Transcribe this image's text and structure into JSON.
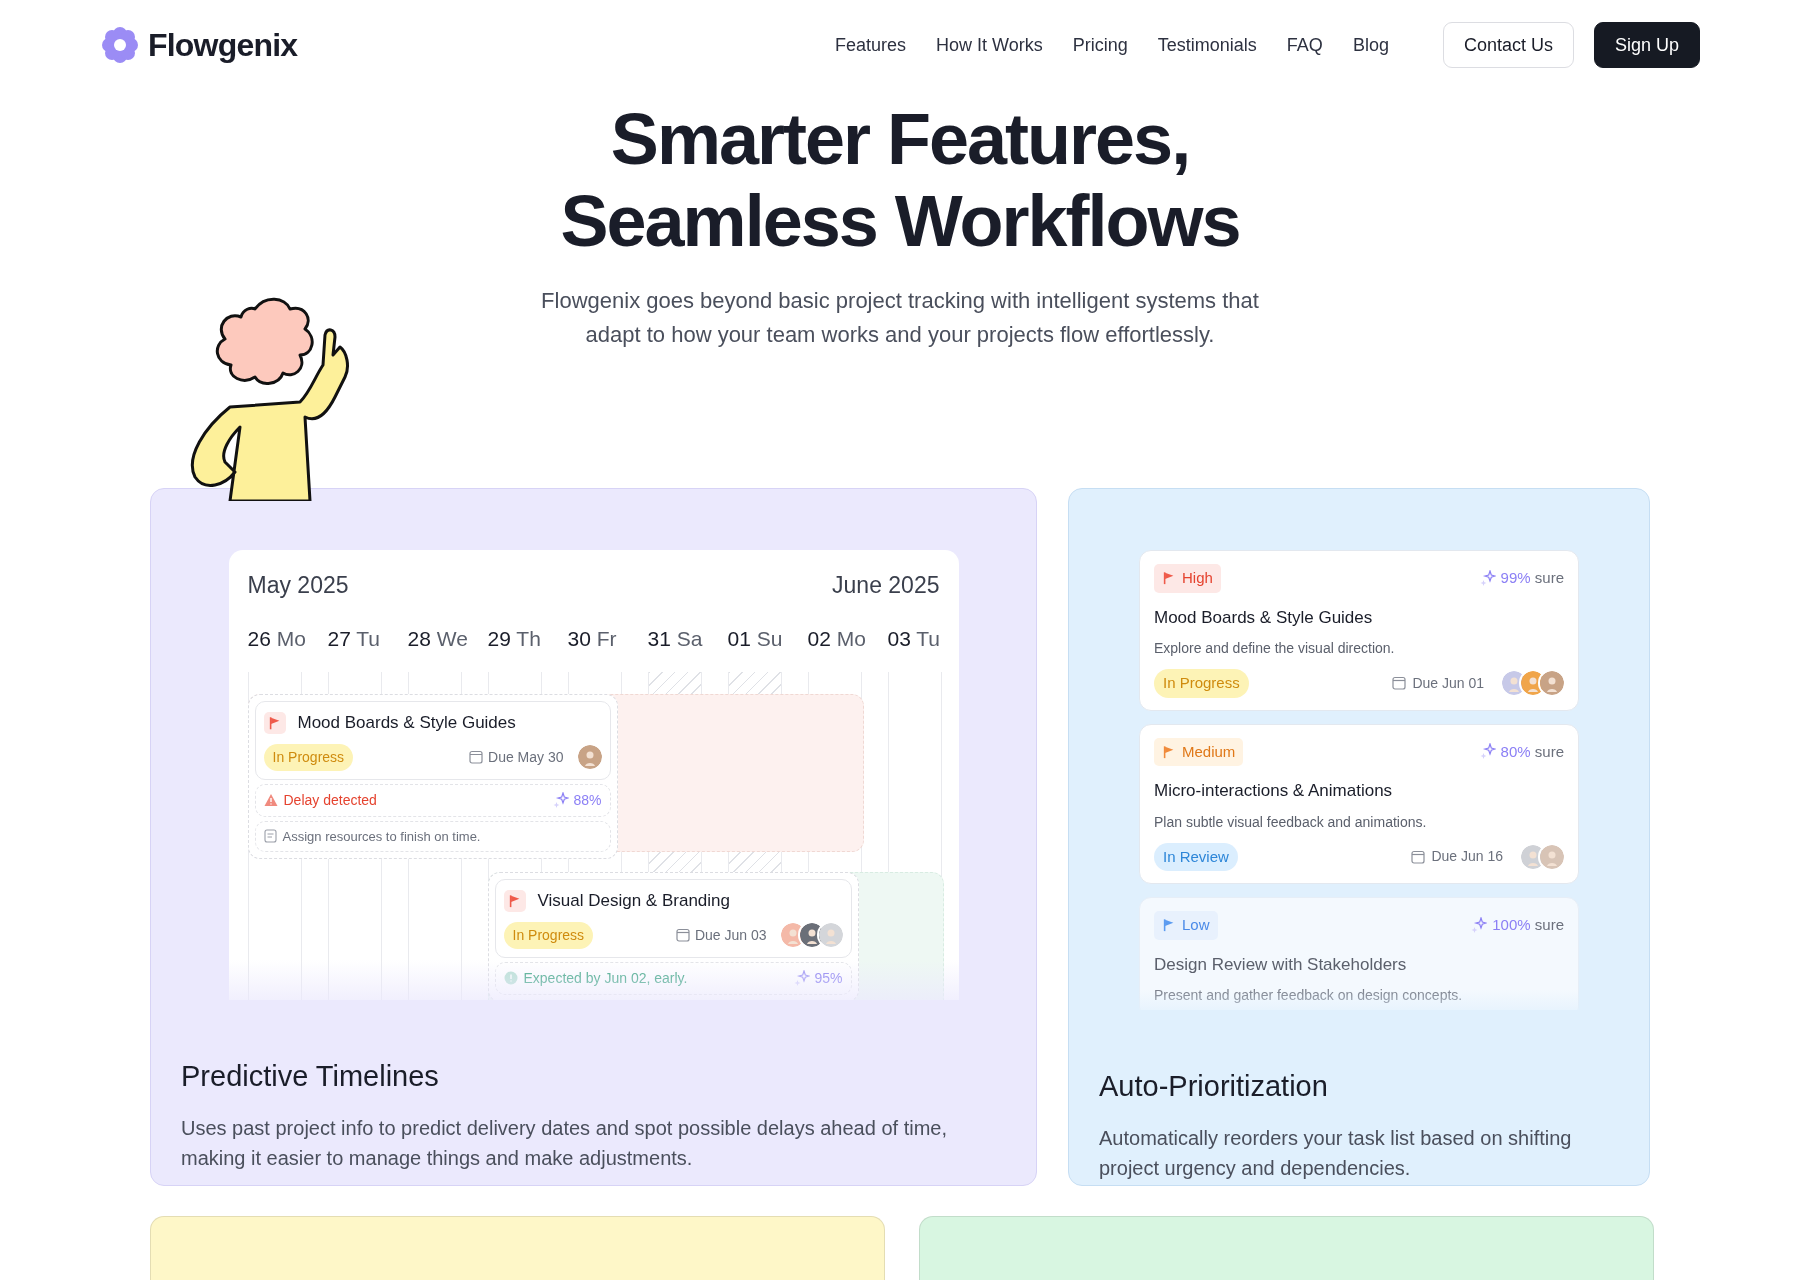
{
  "nav": {
    "brand": "Flowgenix",
    "links": [
      {
        "label": "Features"
      },
      {
        "label": "How It Works"
      },
      {
        "label": "Pricing"
      },
      {
        "label": "Testimonials"
      },
      {
        "label": "FAQ"
      },
      {
        "label": "Blog"
      }
    ],
    "buttons": [
      {
        "label": "Contact Us",
        "kind": "outline"
      },
      {
        "label": "Sign Up",
        "kind": "solid"
      }
    ]
  },
  "hero": {
    "title": [
      "Smarter Features,",
      "Seamless Workflows"
    ],
    "subtitle": "Flowgenix goes beyond basic project tracking with intelligent systems that adapt to how your team works and your projects flow effortlessly."
  },
  "features": [
    {
      "kind": "timeline",
      "title": "Predictive Timelines",
      "description": "Uses past project info to predict delivery dates and spot possible delays ahead of time, making it easier to manage things and make adjustments.",
      "timeline": {
        "months": [
          "May 2025",
          "June 2025"
        ],
        "days": [
          {
            "num": "26",
            "name": "Mo",
            "weekend": false
          },
          {
            "num": "27",
            "name": "Tu",
            "weekend": false
          },
          {
            "num": "28",
            "name": "We",
            "weekend": false
          },
          {
            "num": "29",
            "name": "Th",
            "weekend": false
          },
          {
            "num": "30",
            "name": "Fr",
            "weekend": false
          },
          {
            "num": "31",
            "name": "Sa",
            "weekend": true
          },
          {
            "num": "01",
            "name": "Su",
            "weekend": true
          },
          {
            "num": "02",
            "name": "Mo",
            "weekend": false
          },
          {
            "num": "03",
            "name": "Tu",
            "weekend": false
          }
        ],
        "tasks": [
          {
            "title": "Mood Boards & Style Guides",
            "status": {
              "label": "In Progress",
              "kind": "progress"
            },
            "due": "Due May 30",
            "avatars": [
              {
                "color": "#c8a386"
              }
            ],
            "forecast": {
              "kind": "delay",
              "text": "Delay detected",
              "confidence": "88%"
            },
            "note": "Assign resources to finish on time."
          },
          {
            "title": "Visual Design & Branding",
            "status": {
              "label": "In Progress",
              "kind": "progress"
            },
            "due": "Due Jun 03",
            "avatars": [
              {
                "color": "#f4b9a8"
              },
              {
                "color": "#6b6f78"
              },
              {
                "color": "#d4d6da"
              }
            ],
            "forecast": {
              "kind": "early",
              "text": "Expected by Jun 02, early.",
              "confidence": "95%"
            }
          }
        ]
      }
    },
    {
      "kind": "priority",
      "title": "Auto-Prioritization",
      "description": "Automatically reorders your task list based on shifting project urgency and dependencies.",
      "tasks": [
        {
          "priority": {
            "label": "High",
            "kind": "high"
          },
          "confidence": "99%",
          "sure": "sure",
          "title": "Mood Boards & Style Guides",
          "description": "Explore and define the visual direction.",
          "status": {
            "label": "In Progress",
            "kind": "progress"
          },
          "due": "Due Jun 01",
          "avatars": [
            {
              "color": "#c7c9e8"
            },
            {
              "color": "#f0a54a"
            },
            {
              "color": "#c8a386"
            }
          ],
          "faded": false
        },
        {
          "priority": {
            "label": "Medium",
            "kind": "medium"
          },
          "confidence": "80%",
          "sure": "sure",
          "title": "Micro-interactions & Animations",
          "description": "Plan subtle visual feedback and animations.",
          "status": {
            "label": "In Review",
            "kind": "review"
          },
          "due": "Due Jun 16",
          "avatars": [
            {
              "color": "#cfd1d6"
            },
            {
              "color": "#d8c4b6"
            }
          ],
          "faded": false
        },
        {
          "priority": {
            "label": "Low",
            "kind": "low"
          },
          "confidence": "100%",
          "sure": "sure",
          "title": "Design Review with Stakeholders",
          "description": "Present and gather feedback on design concepts.",
          "faded": true
        }
      ]
    }
  ],
  "more_cards": [
    {
      "color": "#fef7c8"
    },
    {
      "color": "#d8f6e1"
    }
  ]
}
